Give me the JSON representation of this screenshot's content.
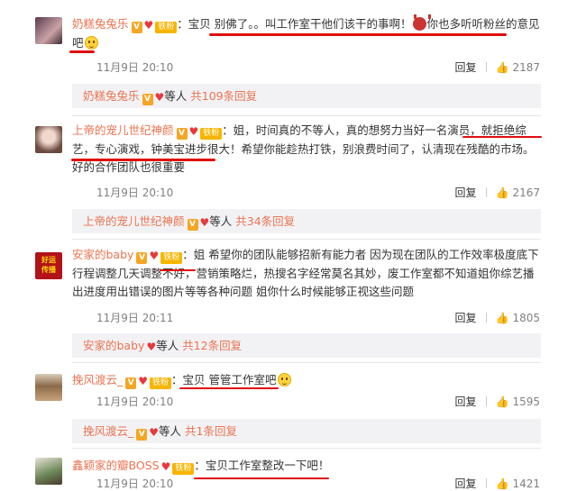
{
  "comments": [
    {
      "username": "奶糕兔兔乐",
      "text_a": "：宝贝 别佛了。。叫工作室干他们该干的事啊！",
      "text_b": "你也多听听粉丝的意见吧",
      "time": "11月9日 20:10",
      "reply_label": "回复",
      "likes": "2187",
      "replies": {
        "username": "奶糕兔兔乐",
        "suffix": "等人",
        "link": "共109条回复"
      }
    },
    {
      "username": "上帝的宠儿世纪神颜",
      "text": "：姐，时间真的不等人，真的想努力当好一名演员，就拒绝综艺，专心演戏，钟美宝进步很大！希望你能趁热打铁，别浪费时间了，认清现在残酷的市场。好的合作团队也很重要",
      "time": "11月9日 20:10",
      "reply_label": "回复",
      "likes": "2167",
      "replies": {
        "username": "上帝的宠儿世纪神颜",
        "suffix": "等人",
        "link": "共34条回复"
      }
    },
    {
      "username": "安家的baby",
      "text": "：姐 希望你的团队能够招新有能力者 因为现在团队的工作效率极度底下 行程调整几天调整不好，营销策略烂，热搜名字经常莫名其妙，废工作室都不知道姐你综艺播出进度用出错误的图片等等各种问题 姐你什么时候能够正视这些问题",
      "avatar_text": "好运\n传播",
      "time": "11月9日 20:11",
      "reply_label": "回复",
      "likes": "1805",
      "replies": {
        "username": "安家的baby",
        "suffix": "等人",
        "link": "共12条回复"
      }
    },
    {
      "username": "挽风渡云_",
      "text": "：宝贝 管管工作室吧",
      "time": "11月9日 20:10",
      "reply_label": "回复",
      "likes": "1595",
      "replies": {
        "username": "挽风渡云_",
        "suffix": "等人",
        "link": "共1条回复"
      }
    },
    {
      "username": "鑫颖家的瓣BOSS",
      "text": "：宝贝工作室整改一下吧！",
      "time": "11月9日 20:10",
      "reply_label": "回复",
      "likes": "1421"
    }
  ],
  "badges": {
    "v": "V",
    "fan": "铁粉"
  },
  "icons": {
    "like": "thumbs-up-icon",
    "heart": "heart-icon",
    "emoji": "smile-emoji-icon",
    "devil": "devil-emoji-icon"
  },
  "colors": {
    "username": "#eb7350",
    "underline": "#e00d0d",
    "reply_bg": "#f2f2f5",
    "meta": "#808080"
  }
}
